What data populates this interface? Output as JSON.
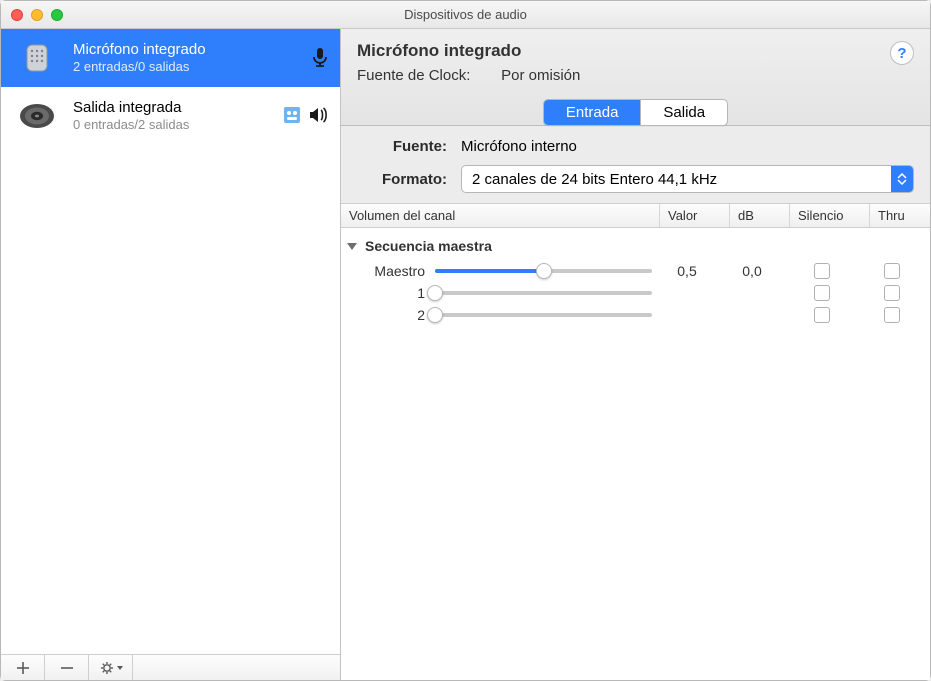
{
  "window": {
    "title": "Dispositivos de audio"
  },
  "sidebar": {
    "devices": [
      {
        "name": "Micrófono integrado",
        "sub": "2 entradas/0 salidas"
      },
      {
        "name": "Salida integrada",
        "sub": "0 entradas/2 salidas"
      }
    ]
  },
  "header": {
    "device_name": "Micrófono integrado",
    "clock_label": "Fuente de Clock:",
    "clock_value": "Por omisión",
    "tabs": {
      "input": "Entrada",
      "output": "Salida"
    }
  },
  "panel": {
    "fuente_label": "Fuente:",
    "fuente_value": "Micrófono interno",
    "formato_label": "Formato:",
    "formato_value": "2 canales de 24 bits Entero 44,1 kHz"
  },
  "table": {
    "columns": {
      "channel": "Volumen del canal",
      "valor": "Valor",
      "db": "dB",
      "silencio": "Silencio",
      "thru": "Thru"
    },
    "group_label": "Secuencia maestra",
    "rows": {
      "master": {
        "label": "Maestro",
        "valor": "0,5",
        "db": "0,0",
        "fill_pct": 50
      },
      "ch1": {
        "label": "1",
        "fill_pct": 0
      },
      "ch2": {
        "label": "2",
        "fill_pct": 0
      }
    }
  },
  "help_glyph": "?"
}
